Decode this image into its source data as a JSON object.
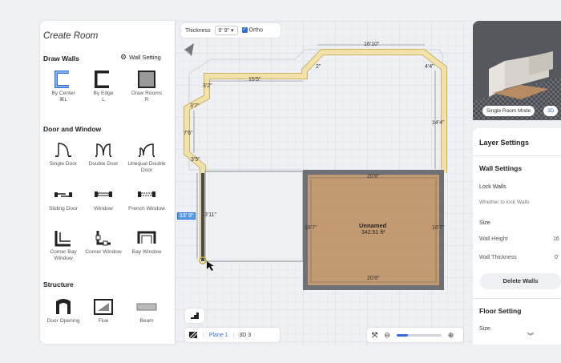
{
  "left_panel": {
    "title": "Create Room",
    "draw_walls": {
      "heading": "Draw Walls",
      "wall_setting": "Wall Setting",
      "tools": [
        {
          "label": "By Center",
          "shortcut": "⌘L"
        },
        {
          "label": "By Edge",
          "shortcut": "L"
        },
        {
          "label": "Draw Rooms",
          "shortcut": "R"
        }
      ]
    },
    "door_window": {
      "heading": "Door and Window",
      "tools": [
        {
          "label": "Single Door"
        },
        {
          "label": "Double Door"
        },
        {
          "label": "Unequal Double Door"
        },
        {
          "label": "Sliding Door"
        },
        {
          "label": "Window"
        },
        {
          "label": "French Window"
        },
        {
          "label": "Corner Bay Window"
        },
        {
          "label": "Corner Window"
        },
        {
          "label": "Bay Window"
        }
      ]
    },
    "structure": {
      "heading": "Structure",
      "tools": [
        {
          "label": "Door Opening"
        },
        {
          "label": "Flue"
        },
        {
          "label": "Beam"
        }
      ]
    }
  },
  "top_toolbar": {
    "thickness_label": "Thickness",
    "thickness_value": "0' 9\"",
    "ortho_label": "Ortho"
  },
  "canvas": {
    "dimensions": [
      "16'10\"",
      "15'5\"",
      "2\"",
      "4'4\"",
      "3'2\"",
      "3'7\"",
      "7'6\"",
      "3'5\"",
      "14'4\"",
      "3'11\"",
      "13' 9\"",
      "20'8\"",
      "20'8\"",
      "16'7\"",
      "16'7\""
    ],
    "room": {
      "name": "Unnamed",
      "area": "342.51 ft²"
    }
  },
  "bottom_bar": {
    "plane_label": "Plane 1",
    "view_3d_label": "3D 3"
  },
  "preview": {
    "mode_button": "Single Room Mode",
    "view_button": "3D"
  },
  "right_panel": {
    "layer_settings": "Layer Settings",
    "wall_settings": "Wall Settings",
    "lock_walls": "Lock Walls",
    "lock_walls_hint": "Whether to lock Walls",
    "size": "Size",
    "wall_height": "Wall Height",
    "wall_height_value": "16",
    "wall_thickness": "Wall Thickness",
    "wall_thickness_value": "0'",
    "delete_walls": "Delete Walls",
    "floor_setting": "Floor Setting",
    "floor_size": "Size"
  },
  "colors": {
    "accent": "#2f6fd6",
    "wall_highlight": "#f2e2a8",
    "wall_dark": "#6e7075",
    "floor": "#c49a72"
  }
}
